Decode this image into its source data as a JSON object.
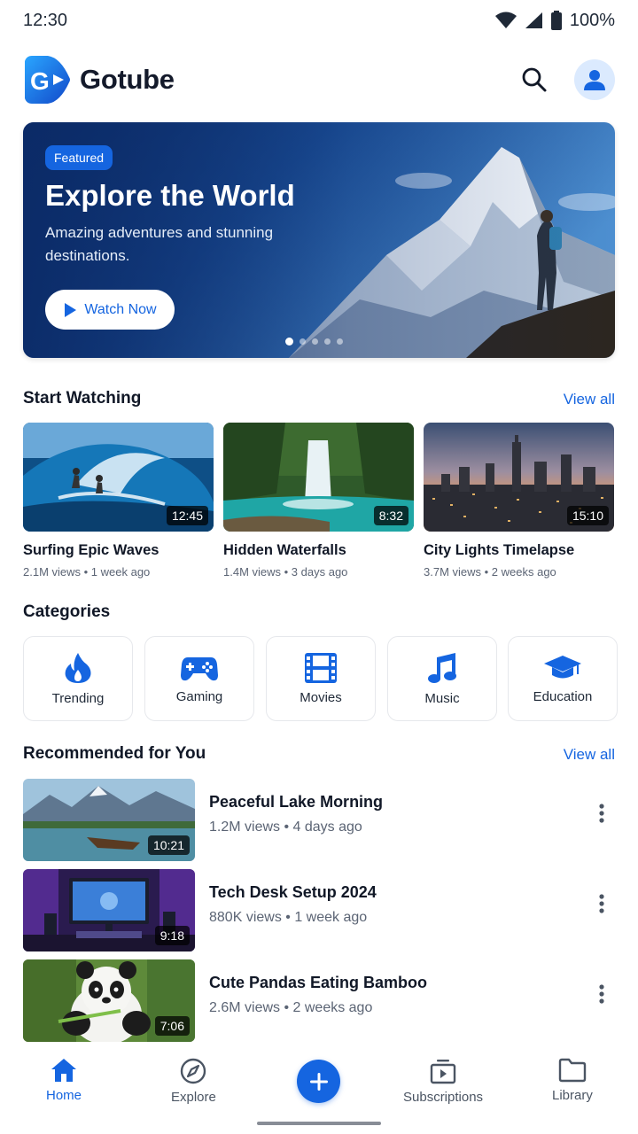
{
  "status_bar": {
    "time": "12:30",
    "battery": "100%"
  },
  "app": {
    "name": "Gotube",
    "logo_letter": "G",
    "brand_color": "#1565e0"
  },
  "header": {
    "search_icon": "search-icon",
    "avatar_icon": "person-icon"
  },
  "hero": {
    "badge": "Featured",
    "title": "Explore the World",
    "subtitle": "Amazing adventures and stunning destinations.",
    "button_label": "Watch Now",
    "slides_count": 5,
    "active_slide": 1
  },
  "start_watching": {
    "title": "Start Watching",
    "view_all": "View all",
    "items": [
      {
        "title": "Surfing Epic Waves",
        "meta": "2.1M views • 1 week ago",
        "duration": "12:45"
      },
      {
        "title": "Hidden Waterfalls",
        "meta": "1.4M views • 3 days ago",
        "duration": "8:32"
      },
      {
        "title": "City Lights Timelapse",
        "meta": "3.7M views • 2 weeks ago",
        "duration": "15:10"
      }
    ]
  },
  "categories": {
    "title": "Categories",
    "items": [
      {
        "label": "Trending",
        "icon": "fire-icon"
      },
      {
        "label": "Gaming",
        "icon": "gamepad-icon"
      },
      {
        "label": "Movies",
        "icon": "film-icon"
      },
      {
        "label": "Music",
        "icon": "music-note-icon"
      },
      {
        "label": "Education",
        "icon": "graduation-cap-icon"
      }
    ]
  },
  "recommended": {
    "title": "Recommended for You",
    "view_all": "View all",
    "items": [
      {
        "title": "Peaceful Lake Morning",
        "meta": "1.2M views • 4 days ago",
        "duration": "10:21"
      },
      {
        "title": "Tech Desk Setup 2024",
        "meta": "880K views • 1 week ago",
        "duration": "9:18"
      },
      {
        "title": "Cute Pandas Eating Bamboo",
        "meta": "2.6M views • 2 weeks ago",
        "duration": "7:06"
      }
    ]
  },
  "bottom_nav": {
    "items": [
      {
        "label": "Home",
        "icon": "home-icon",
        "active": true
      },
      {
        "label": "Explore",
        "icon": "compass-icon"
      },
      {
        "label": "",
        "icon": "plus-icon"
      },
      {
        "label": "Subscriptions",
        "icon": "subscriptions-icon"
      },
      {
        "label": "Library",
        "icon": "folder-icon"
      }
    ]
  }
}
